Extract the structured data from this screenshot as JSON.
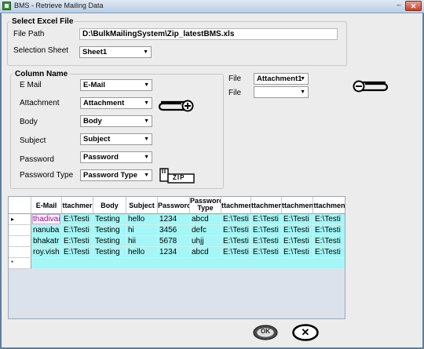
{
  "window": {
    "title": "BMS - Retrieve Mailing Data",
    "minimize_glyph": "–",
    "close_glyph": "✕"
  },
  "excel": {
    "legend": "Select Excel File",
    "file_path_label": "File Path",
    "file_path_value": "D:\\BulkMailingSystem\\Zip_latestBMS.xls",
    "sheet_label": "Selection Sheet",
    "sheet_value": "Sheet1"
  },
  "columns": {
    "legend": "Column Name",
    "rows": [
      {
        "label": "E Mail",
        "value": "E-Mail"
      },
      {
        "label": "Attachment",
        "value": "Attachment"
      },
      {
        "label": "Body",
        "value": "Body"
      },
      {
        "label": "Subject",
        "value": "Subject"
      },
      {
        "label": "Password",
        "value": "Password"
      },
      {
        "label": "Password Type",
        "value": "Password Type"
      }
    ]
  },
  "files": {
    "rows": [
      {
        "label": "File",
        "value": "Attachment1"
      },
      {
        "label": "File",
        "value": ""
      }
    ]
  },
  "grid": {
    "headers": [
      "E-Mail",
      "ttachmer",
      "Body",
      "Subject",
      "Passworc",
      "Passworc\nType",
      "ttachmen",
      "ttachmen",
      "ttachmen",
      "ttachmen"
    ],
    "rows": [
      {
        "marker": "▸",
        "cells": [
          "thadivai",
          "E:\\Testi",
          "Testing",
          "hello",
          "1234",
          "abcd",
          "E:\\Testi",
          "E:\\Testi",
          "E:\\Testi",
          "E:\\Testi"
        ]
      },
      {
        "marker": "",
        "cells": [
          "nanuba",
          "E:\\Testi",
          "Testing",
          "hi",
          "3456",
          "defc",
          "E:\\Testi",
          "E:\\Testi",
          "E:\\Testi",
          "E:\\Testi"
        ]
      },
      {
        "marker": "",
        "cells": [
          "bhakatr",
          "E:\\Testi",
          "Testing",
          "hii",
          "5678",
          "uhjj",
          "E:\\Testi",
          "E:\\Testi",
          "E:\\Testi",
          "E:\\Testi"
        ]
      },
      {
        "marker": "",
        "cells": [
          "roy.vish",
          "E:\\Testi",
          "Testing",
          "hello",
          "1234",
          "abcd",
          "E:\\Testi",
          "E:\\Testi",
          "E:\\Testi",
          "E:\\Testi"
        ]
      }
    ],
    "new_row_marker": "*"
  },
  "buttons": {
    "ok_label": "OK",
    "cancel_glyph": "✕"
  },
  "icons": {
    "add_attachment": "paperclip-add-icon",
    "zip": "zip-icon",
    "remove_attachment": "paperclip-remove-icon"
  },
  "zip_label": "ZIP"
}
